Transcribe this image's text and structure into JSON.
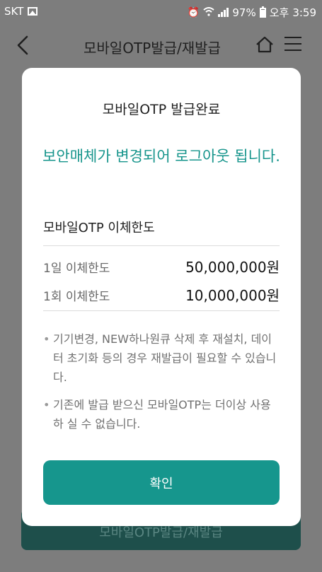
{
  "status_bar": {
    "carrier": "SKT",
    "battery": "97%",
    "ampm": "오후",
    "time": "3:59",
    "icons": [
      "image-icon",
      "alarm-icon",
      "wifi-icon",
      "signal-icon",
      "battery-icon"
    ]
  },
  "header": {
    "title": "모바일OTP발급/재발급",
    "icons": [
      "back-icon",
      "home-icon",
      "menu-icon"
    ]
  },
  "background_button": {
    "label": "모바일OTP발급/재발급"
  },
  "modal": {
    "title": "모바일OTP 발급완료",
    "message": "보안매체가 변경되어 로그아웃 됩니다.",
    "section_title": "모바일OTP 이체한도",
    "limits": [
      {
        "label": "1일 이체한도",
        "value": "50,000,000원"
      },
      {
        "label": "1회 이체한도",
        "value": "10,000,000원"
      }
    ],
    "notes": [
      "기기변경, NEW하나원큐 삭제 후 재설치, 데이터 초기화 등의 경우 재발급이 필요할 수 있습니다.",
      "기존에 발급 받으신 모바일OTP는 더이상 사용하 실 수 없습니다."
    ],
    "confirm_label": "확인"
  },
  "colors": {
    "accent": "#16968d",
    "dim_background": "#7d7d7d",
    "text": "#1f1f1f"
  }
}
